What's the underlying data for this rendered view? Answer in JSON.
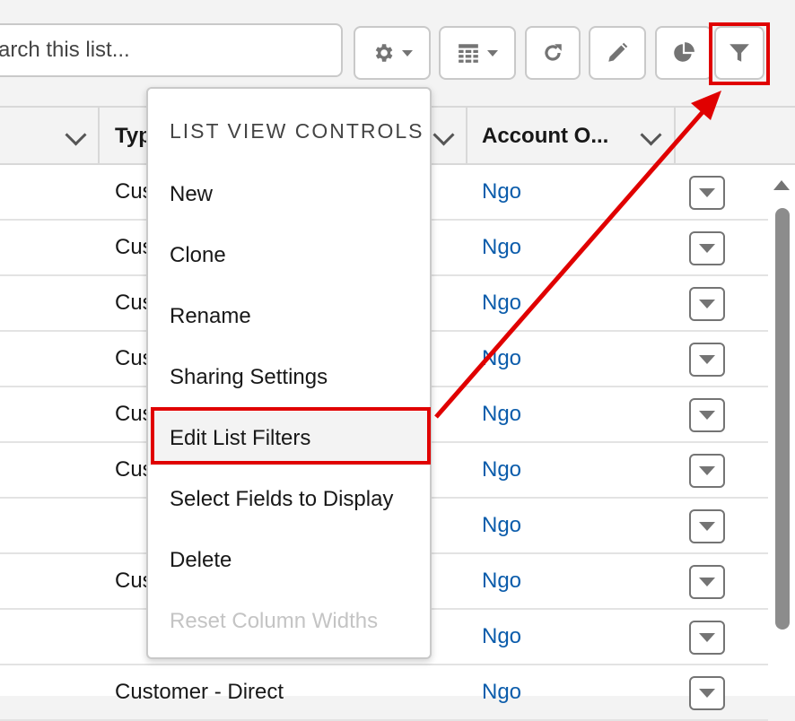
{
  "search": {
    "placeholder": "arch this list..."
  },
  "toolbar": {
    "settings_icon": "gear-icon",
    "display_icon": "table-icon",
    "refresh_icon": "refresh-icon",
    "edit_icon": "pencil-icon",
    "chart_icon": "pie-chart-icon",
    "filter_icon": "filter-icon"
  },
  "table": {
    "headers": {
      "type": "Typ",
      "owner": "Account O..."
    },
    "rows": [
      {
        "type": "Cus",
        "owner": "Ngo"
      },
      {
        "type": "Cus",
        "owner": "Ngo"
      },
      {
        "type": "Cus",
        "owner": "Ngo"
      },
      {
        "type": "Cus",
        "owner": "Ngo"
      },
      {
        "type": "Cus",
        "owner": "Ngo"
      },
      {
        "type": "Cus",
        "owner": "Ngo"
      },
      {
        "type": "",
        "owner": "Ngo"
      },
      {
        "type": "Cus",
        "owner": "Ngo"
      },
      {
        "type": "",
        "owner": "Ngo"
      },
      {
        "type": "Customer - Direct",
        "owner": "Ngo"
      }
    ]
  },
  "menu": {
    "title": "LIST VIEW CONTROLS",
    "items": [
      {
        "label": "New",
        "state": "normal"
      },
      {
        "label": "Clone",
        "state": "normal"
      },
      {
        "label": "Rename",
        "state": "normal"
      },
      {
        "label": "Sharing Settings",
        "state": "normal"
      },
      {
        "label": "Edit List Filters",
        "state": "active"
      },
      {
        "label": "Select Fields to Display",
        "state": "normal"
      },
      {
        "label": "Delete",
        "state": "normal"
      },
      {
        "label": "Reset Column Widths",
        "state": "disabled"
      }
    ]
  },
  "colors": {
    "annotation": "#e00000",
    "link": "#0b5cab"
  }
}
